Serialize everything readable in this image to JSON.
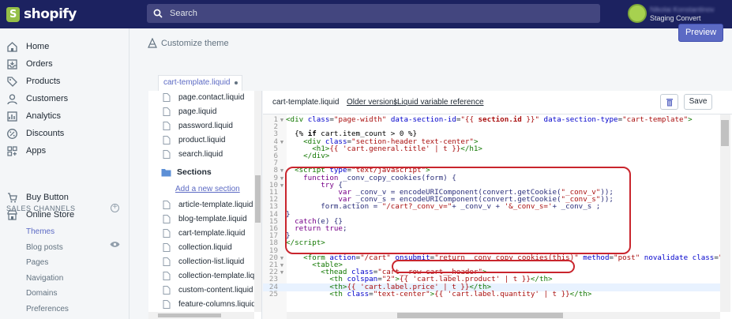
{
  "brand": {
    "name": "shopify",
    "accent": "#95bf47",
    "topbar": "#1c2260",
    "highlight": "#c9252d"
  },
  "search": {
    "label": "Search"
  },
  "user": {
    "name": "Nikolai Konstantinov",
    "store": "Staging Convert"
  },
  "preview_label": "Preview",
  "sidebar": {
    "items": [
      {
        "label": "Home",
        "icon": "home-icon"
      },
      {
        "label": "Orders",
        "icon": "orders-icon"
      },
      {
        "label": "Products",
        "icon": "tag-icon"
      },
      {
        "label": "Customers",
        "icon": "person-icon"
      },
      {
        "label": "Analytics",
        "icon": "analytics-icon"
      },
      {
        "label": "Discounts",
        "icon": "discount-icon"
      },
      {
        "label": "Apps",
        "icon": "apps-icon"
      }
    ],
    "channels_title": "SALES CHANNELS",
    "channels": [
      {
        "label": "Buy Button",
        "icon": "buy-button-icon"
      },
      {
        "label": "Online Store",
        "icon": "store-icon"
      }
    ],
    "store_subitems": [
      "Themes",
      "Blog posts",
      "Pages",
      "Navigation",
      "Domains",
      "Preferences"
    ]
  },
  "customize_label": "Customize theme",
  "tab": {
    "label": "cart-template.liquid"
  },
  "filetree": {
    "files_top": [
      "page.contact.liquid",
      "page.liquid",
      "password.liquid",
      "product.liquid",
      "search.liquid"
    ],
    "sections_label": "Sections",
    "add_section": "Add a new section",
    "section_files": [
      "article-template.liquid",
      "blog-template.liquid",
      "cart-template.liquid",
      "collection.liquid",
      "collection-list.liquid",
      "collection-template.liquid",
      "custom-content.liquid",
      "feature-columns.liquid"
    ]
  },
  "editor": {
    "filename": "cart-template.liquid",
    "older_versions": "Older versions",
    "separator": "|",
    "liquid_ref": "Liquid variable reference",
    "save_label": "Save"
  },
  "code_lines": [
    {
      "n": "1",
      "fold": "▼",
      "html": "<span class=\"tag\">&lt;div</span> <span class=\"attr\">class</span>=<span class=\"str\">\"page-width\"</span> <span class=\"attr\">data-section-id</span>=<span class=\"str\">\"{{ <b>section.id</b> }}\"</span> <span class=\"attr\">data-section-type</span>=<span class=\"str\">\"cart-template\"</span><span class=\"tag\">&gt;</span>"
    },
    {
      "n": "2",
      "fold": "",
      "html": ""
    },
    {
      "n": "3",
      "fold": "",
      "html": "  <span class=\"tpl\">{% <b>if</b> cart.item_count &gt; 0 %}</span>"
    },
    {
      "n": "4",
      "fold": "▼",
      "html": "    <span class=\"tag\">&lt;div</span> <span class=\"attr\">class</span>=<span class=\"str\">\"section-header text-center\"</span><span class=\"tag\">&gt;</span>"
    },
    {
      "n": "5",
      "fold": "",
      "html": "      <span class=\"tag\">&lt;h1&gt;</span><span class=\"str\">{{ 'cart.general.title' | t }}</span><span class=\"tag\">&lt;/h1&gt;</span>"
    },
    {
      "n": "6",
      "fold": "",
      "html": "    <span class=\"tag\">&lt;/div&gt;</span>"
    },
    {
      "n": "7",
      "fold": "",
      "html": ""
    },
    {
      "n": "8",
      "fold": "▼",
      "html": "  <span class=\"tag\">&lt;script</span> <span class=\"attr\">type</span>=<span class=\"str\">\"text/javascript\"</span><span class=\"tag\">&gt;</span>"
    },
    {
      "n": "9",
      "fold": "▼",
      "html": "    <span class=\"kw\">function</span> <span class=\"code\">_conv_copy_cookies(form) {</span>"
    },
    {
      "n": "10",
      "fold": "▼",
      "html": "        <span class=\"kw\">try</span> <span class=\"code\">{</span>"
    },
    {
      "n": "11",
      "fold": "",
      "html": "            <span class=\"kw\">var</span> <span class=\"code\">_conv_v = encodeURIComponent(convert.getCookie(</span><span class=\"str\">\"_conv_v\"</span><span class=\"code\">));</span>"
    },
    {
      "n": "12",
      "fold": "",
      "html": "            <span class=\"kw\">var</span> <span class=\"code\">_conv_s = encodeURIComponent(convert.getCookie(</span><span class=\"str\">\"_conv_s\"</span><span class=\"code\">));</span>"
    },
    {
      "n": "13",
      "fold": "",
      "html": "        <span class=\"code\">form.action = </span><span class=\"str\">\"/cart?_conv_v=\"</span><span class=\"code\">+ _conv_v + </span><span class=\"str\">'&amp;_conv_s='</span><span class=\"code\">+ _conv_s ;</span>"
    },
    {
      "n": "14",
      "fold": "",
      "html": "<span class=\"code\">}</span>"
    },
    {
      "n": "15",
      "fold": "",
      "html": "  <span class=\"kw\">catch</span><span class=\"code\">(e) {}</span>"
    },
    {
      "n": "16",
      "fold": "",
      "html": "  <span class=\"kw\">return</span> <span class=\"kw\">true</span><span class=\"code\">;</span>"
    },
    {
      "n": "17",
      "fold": "",
      "html": "<span class=\"code\">}</span>"
    },
    {
      "n": "18",
      "fold": "",
      "html": "<span class=\"tag\">&lt;/script&gt;</span>"
    },
    {
      "n": "19",
      "fold": "",
      "html": ""
    },
    {
      "n": "20",
      "fold": "▼",
      "html": "    <span class=\"tag\">&lt;form</span> <span class=\"attr\">action</span>=<span class=\"str\">\"/cart\"</span> <span class=\"attr\">onsubmit</span>=<span class=\"str\">\"return _conv_copy_cookies(this)\"</span> <span class=\"attr\">method</span>=<span class=\"str\">\"post\"</span> <span class=\"attr\">novalidate</span> <span class=\"attr\">class</span>=<span class=\"str\">\"c</span>"
    },
    {
      "n": "21",
      "fold": "▼",
      "html": "      <span class=\"tag\">&lt;table&gt;</span>"
    },
    {
      "n": "22",
      "fold": "▼",
      "html": "        <span class=\"tag\">&lt;thead</span> <span class=\"attr\">class</span>=<span class=\"str\">\"cart__row cart__header\"</span><span class=\"tag\">&gt;</span>"
    },
    {
      "n": "23",
      "fold": "",
      "html": "          <span class=\"tag\">&lt;th</span> <span class=\"attr\">colspan</span>=<span class=\"str\">\"2\"</span><span class=\"tag\">&gt;</span><span class=\"str\">{{ 'cart.label.product' | t }}</span><span class=\"tag\">&lt;/th&gt;</span>"
    },
    {
      "n": "24",
      "fold": "",
      "html": "          <span class=\"tag\">&lt;th&gt;</span><span class=\"str\">{{ 'cart.label.price' | t }}</span><span class=\"tag\">&lt;/th&gt;</span>"
    },
    {
      "n": "25",
      "fold": "",
      "html": "          <span class=\"tag\">&lt;th</span> <span class=\"attr\">class</span>=<span class=\"str\">\"text-center\"</span><span class=\"tag\">&gt;</span><span class=\"str\">{{ 'cart.label.quantity' | t }}</span><span class=\"tag\">&lt;/th&gt;</span>"
    }
  ]
}
